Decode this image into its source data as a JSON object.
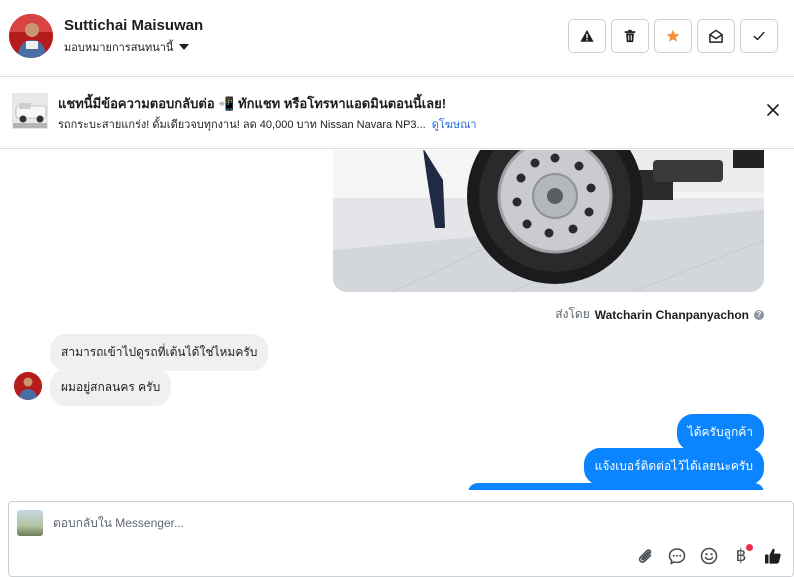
{
  "header": {
    "contact_name": "Suttichai Maisuwan",
    "assign_label": "มอบหมายการสนทนานี้",
    "actions": [
      {
        "name": "spam",
        "icon": "warning-icon"
      },
      {
        "name": "delete",
        "icon": "trash-icon"
      },
      {
        "name": "star",
        "icon": "star-icon",
        "color": "#f7923b"
      },
      {
        "name": "mark-unread",
        "icon": "envelope-open-icon"
      },
      {
        "name": "done",
        "icon": "check-icon"
      }
    ]
  },
  "ad": {
    "title": "แชทนี้มีข้อความตอบกลับต่อ 📲 ทักแชท หรือโทรหาแอดมินตอนนี้เลย!",
    "subtitle": "รถกระบะสายแกร่ง! ดั้มเดียวจบทุกงาน! ลด 40,000 บาท Nissan Navara NP3...",
    "link": "ดูโฆษณา"
  },
  "conversation": {
    "sent_by_prefix": "ส่งโดย",
    "sent_by_name": "Watcharin Chanpanyachon",
    "info_glyph": "?",
    "incoming": [
      "สามารถเข้าไปดูรถที่เต้นได้ใช่ไหมครับ",
      "ผมอยู่สกลนคร ครับ"
    ],
    "outgoing": [
      "ได้ครับลูกค้า",
      "แจ้งเบอร์ติดต่อไว้ได้เลยนะครับ"
    ]
  },
  "composer": {
    "placeholder": "ตอบกลับใน Messenger...",
    "tools": [
      "attach-icon",
      "quick-reply-icon",
      "emoji-icon",
      "baht-payment-icon",
      "thumbs-up-icon"
    ],
    "baht_glyph": "฿"
  },
  "colors": {
    "accent_blue": "#0a84ff",
    "link_blue": "#216fdb",
    "star_orange": "#f7923b",
    "badge_red": "#f02849"
  }
}
